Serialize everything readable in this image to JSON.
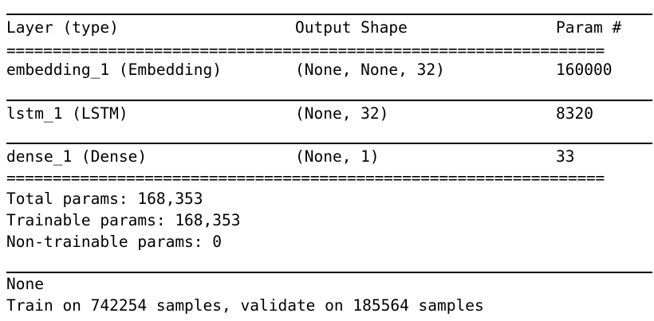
{
  "model_summary": {
    "header": {
      "layer_col": "Layer (type)",
      "shape_col": "Output Shape",
      "param_col": "Param #"
    },
    "separator_char": "=================================================================",
    "rows": [
      {
        "layer": "embedding_1 (Embedding)",
        "shape": "(None, None, 32)",
        "params": "160000"
      },
      {
        "layer": "lstm_1 (LSTM)",
        "shape": "(None, 32)",
        "params": "8320"
      },
      {
        "layer": "dense_1 (Dense)",
        "shape": "(None, 1)",
        "params": "33"
      }
    ],
    "totals": {
      "total": "Total params: 168,353",
      "trainable": "Trainable params: 168,353",
      "non_trainable": "Non-trainable params: 0"
    }
  },
  "output": {
    "return_value": "None",
    "train_message": "Train on 742254 samples, validate on 185564 samples"
  }
}
